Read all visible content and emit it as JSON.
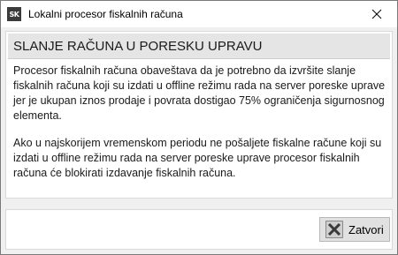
{
  "window": {
    "title": "Lokalni procesor fiskalnih računa",
    "app_icon_text": "SK"
  },
  "dialog": {
    "heading": "SLANJE RAČUNA U PORESKU UPRAVU",
    "paragraph1": "Procesor fiskalnih računa obaveštava da je potrebno da izvršite slanje fiskalnih računa koji su izdati u offline režimu rada na server poreske uprave jer je ukupan iznos prodaje i povrata dostigao 75% ograničenja sigurnosnog elementa.",
    "paragraph2": "Ako u najskorijem vremenskom periodu ne pošaljete fiskalne račune koji su izdati u offline režimu rada na server poreske uprave procesor fiskalnih računa će blokirati izdavanje fiskalnih računa."
  },
  "footer": {
    "close_label": "Zatvori",
    "close_icon": "x-icon"
  },
  "colors": {
    "header_bg": "#e5e5e5",
    "button_bg": "#e1e1e1",
    "icon_color": "#3a3a3a"
  }
}
